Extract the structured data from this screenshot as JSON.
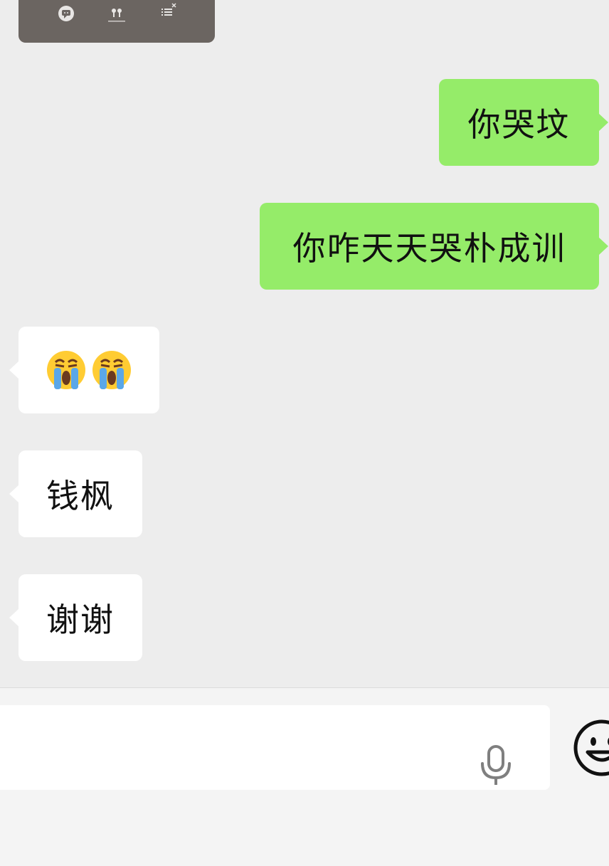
{
  "app": {
    "name": "chat"
  },
  "shared_media": {
    "icons": [
      "message-bubble-icon",
      "earbuds-icon",
      "playlist-icon"
    ]
  },
  "messages": [
    {
      "direction": "out",
      "text": "你哭坟"
    },
    {
      "direction": "out",
      "text": "你咋天天哭朴成训"
    },
    {
      "direction": "in",
      "type": "emoji",
      "emoji": [
        "loudly-crying-face",
        "loudly-crying-face"
      ]
    },
    {
      "direction": "in",
      "text": "钱枫"
    },
    {
      "direction": "in",
      "text": "谢谢"
    }
  ],
  "input_bar": {
    "text_value": "",
    "voice_icon": "microphone-icon",
    "emoji_icon": "smiley-icon"
  },
  "colors": {
    "background": "#ededed",
    "outgoing_bubble": "#95ec69",
    "incoming_bubble": "#ffffff",
    "input_bar": "#f4f4f4"
  }
}
